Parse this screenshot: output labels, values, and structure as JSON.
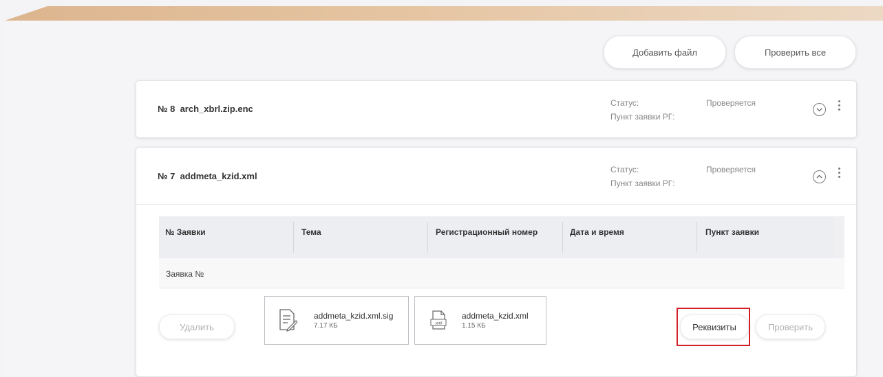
{
  "toolbar": {
    "add_file_label": "Добавить файл",
    "check_all_label": "Проверить все"
  },
  "cards": [
    {
      "number": "№ 8",
      "filename": "arch_xbrl.zip.enc",
      "status_label": "Статус:",
      "status_value": "Проверяется",
      "point_label": "Пункт заявки РГ:",
      "expanded": false
    },
    {
      "number": "№ 7",
      "filename": "addmeta_kzid.xml",
      "status_label": "Статус:",
      "status_value": "Проверяется",
      "point_label": "Пункт заявки РГ:",
      "expanded": true,
      "table": {
        "columns": [
          "№ Заявки",
          "Тема",
          "Регистрационный номер",
          "Дата и время",
          "Пункт заявки"
        ],
        "rows": [
          [
            "Заявка №",
            "",
            "",
            "",
            ""
          ]
        ]
      },
      "files": [
        {
          "name": "addmeta_kzid.xml.sig",
          "size": "7.17 КБ",
          "icon": "signature-file-icon"
        },
        {
          "name": "addmeta_kzid.xml",
          "size": "1.15 КБ",
          "icon": "xml-file-icon",
          "icon_text": ".xml"
        }
      ],
      "actions": {
        "delete_label": "Удалить",
        "details_label": "Реквизиты",
        "check_label": "Проверить"
      }
    }
  ],
  "colors": {
    "banner": "#dcb58e",
    "highlight": "#d21f26",
    "disabled_text": "#b0b0b6"
  }
}
